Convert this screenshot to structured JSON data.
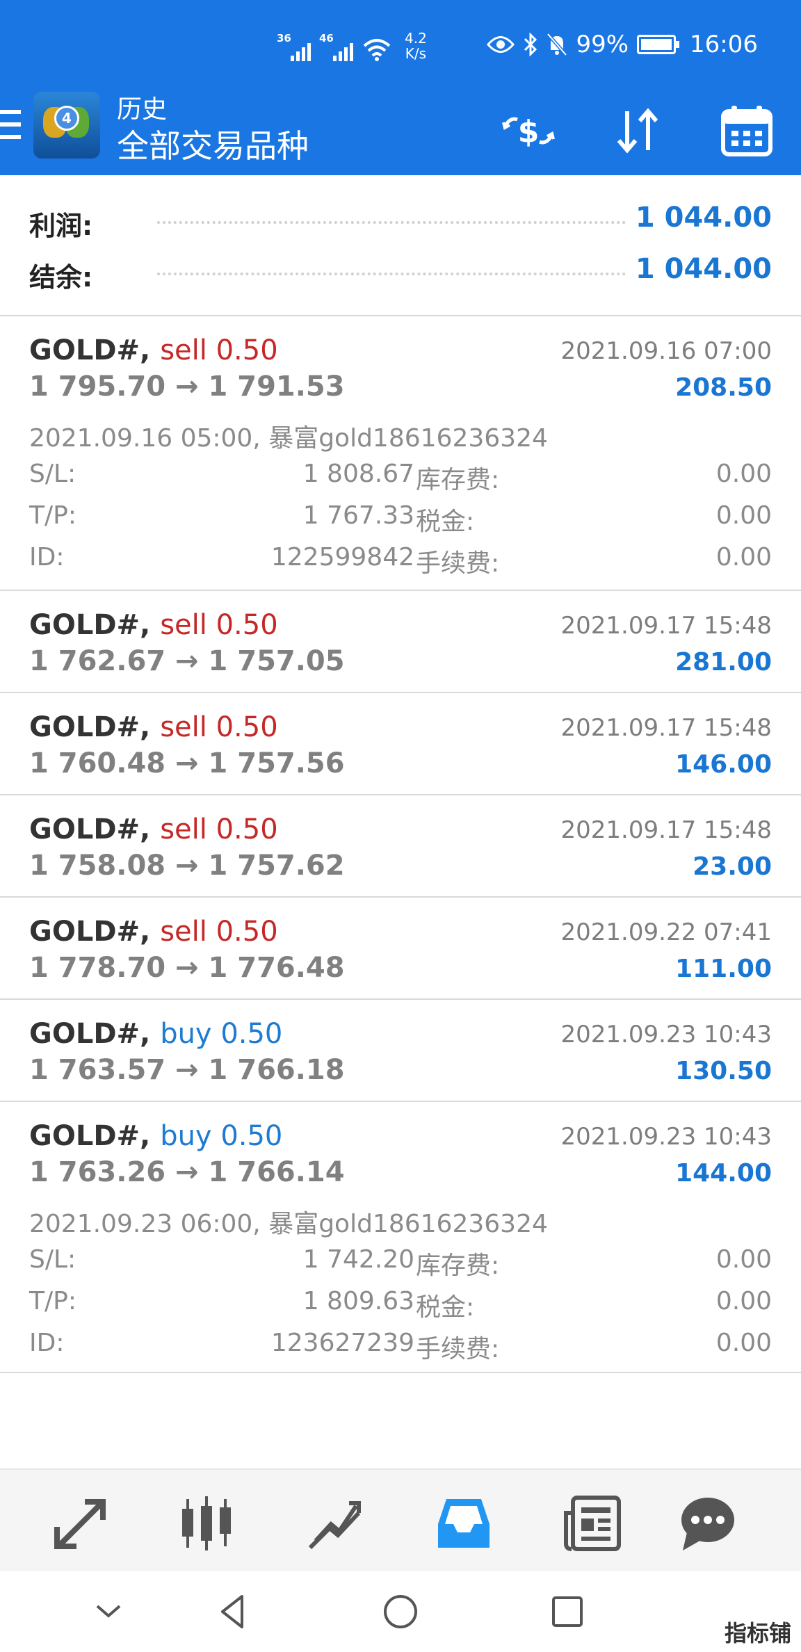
{
  "status_bar": {
    "net1": "36",
    "net2": "46",
    "speed_value": "4.2",
    "speed_unit": "K/s",
    "battery": "99%",
    "battery_level": 0.99,
    "time": "16:06"
  },
  "app_bar": {
    "title": "历史",
    "subtitle": "全部交易品种"
  },
  "summary": {
    "profit_label": "利润:",
    "profit_value": "1 044.00",
    "balance_label": "结余:",
    "balance_value": "1 044.00"
  },
  "trades": [
    {
      "symbol": "GOLD#,",
      "direction": "sell 0.50",
      "time": "2021.09.16 07:00",
      "prices": "1 795.70 → 1 791.53",
      "profit": "208.50",
      "open_info": "2021.09.16 05:00, 暴富gold18616236324",
      "sl_label": "S/L:",
      "sl_value": "1 808.67",
      "tp_label": "T/P:",
      "tp_value": "1 767.33",
      "id_label": "ID:",
      "id_value": "122599842",
      "swap_label": "库存费:",
      "swap_value": "0.00",
      "tax_label": "税金:",
      "tax_value": "0.00",
      "fee_label": "手续费:",
      "fee_value": "0.00"
    },
    {
      "symbol": "GOLD#,",
      "direction": "sell 0.50",
      "time": "2021.09.17 15:48",
      "prices": "1 762.67 → 1 757.05",
      "profit": "281.00"
    },
    {
      "symbol": "GOLD#,",
      "direction": "sell 0.50",
      "time": "2021.09.17 15:48",
      "prices": "1 760.48 → 1 757.56",
      "profit": "146.00"
    },
    {
      "symbol": "GOLD#,",
      "direction": "sell 0.50",
      "time": "2021.09.17 15:48",
      "prices": "1 758.08 → 1 757.62",
      "profit": "23.00"
    },
    {
      "symbol": "GOLD#,",
      "direction": "sell 0.50",
      "time": "2021.09.22 07:41",
      "prices": "1 778.70 → 1 776.48",
      "profit": "111.00"
    },
    {
      "symbol": "GOLD#,",
      "direction": "buy 0.50",
      "time": "2021.09.23 10:43",
      "prices": "1 763.57 → 1 766.18",
      "profit": "130.50"
    },
    {
      "symbol": "GOLD#,",
      "direction": "buy 0.50",
      "time": "2021.09.23 10:43",
      "prices": "1 763.26 → 1 766.14",
      "profit": "144.00",
      "open_info": "2021.09.23 06:00, 暴富gold18616236324",
      "sl_label": "S/L:",
      "sl_value": "1 742.20",
      "tp_label": "T/P:",
      "tp_value": "1 809.63",
      "id_label": "ID:",
      "id_value": "123627239",
      "swap_label": "库存费:",
      "swap_value": "0.00",
      "tax_label": "税金:",
      "tax_value": "0.00",
      "fee_label": "手续费:",
      "fee_value": "0.00"
    }
  ],
  "bottom_nav": {
    "items": [
      "quotes-icon",
      "chart-icon",
      "trade-icon",
      "history-icon",
      "news-icon",
      "chat-icon"
    ],
    "active": "history-icon",
    "active_color": "#2196f3",
    "inactive_color": "#555555"
  },
  "watermark": "指标铺",
  "colors": {
    "primary": "#1976e3",
    "sell": "#c62828",
    "buy": "#1e7bd1",
    "profit": "#1976d2"
  }
}
